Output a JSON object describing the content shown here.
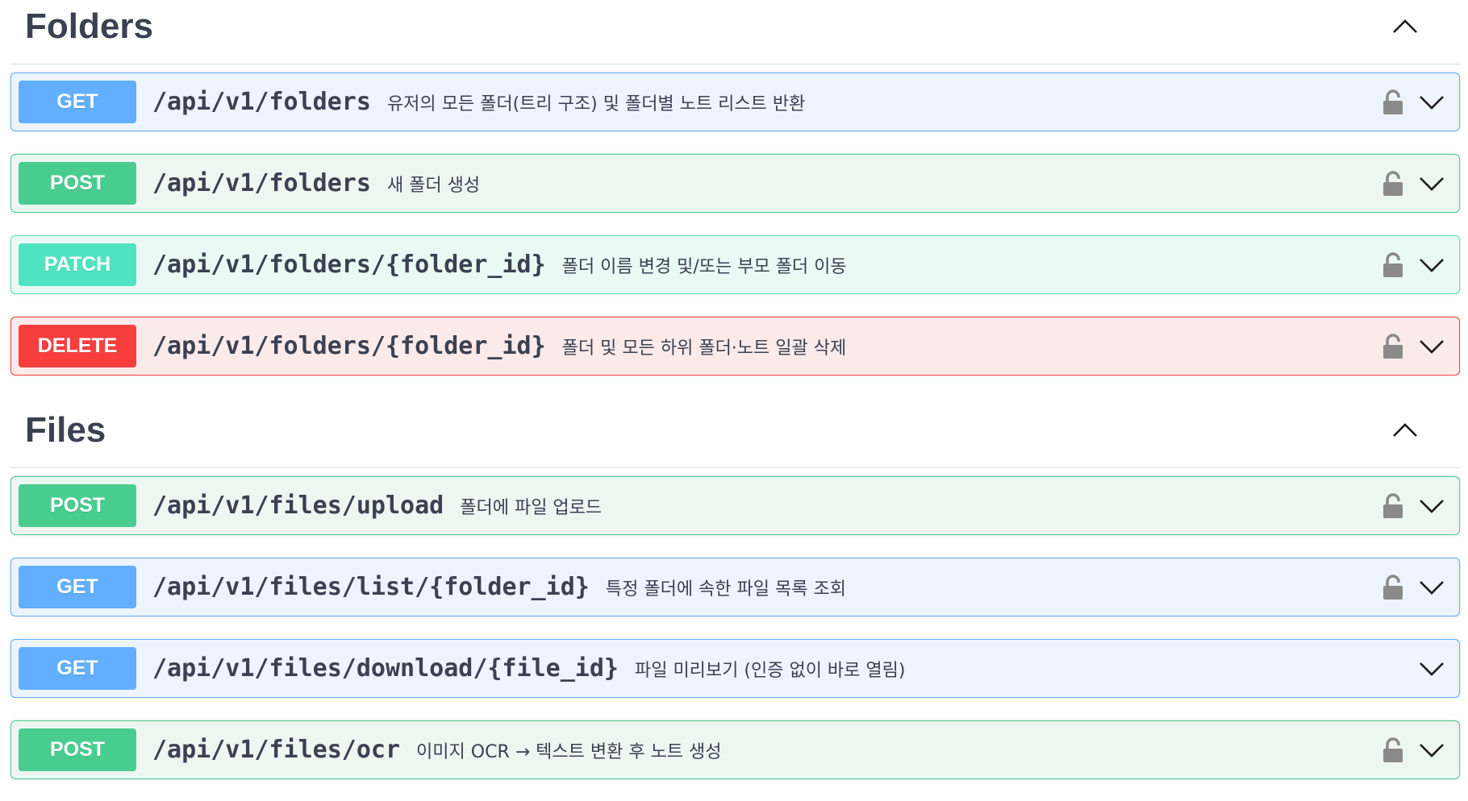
{
  "sections": [
    {
      "title": "Folders",
      "operations": [
        {
          "method": "GET",
          "path": "/api/v1/folders",
          "description": "유저의 모든 폴더(트리 구조) 및 폴더별 노트 리스트 반환",
          "locked": true
        },
        {
          "method": "POST",
          "path": "/api/v1/folders",
          "description": "새 폴더 생성",
          "locked": true
        },
        {
          "method": "PATCH",
          "path": "/api/v1/folders/{folder_id}",
          "description": "폴더 이름 변경 및/또는 부모 폴더 이동",
          "locked": true
        },
        {
          "method": "DELETE",
          "path": "/api/v1/folders/{folder_id}",
          "description": "폴더 및 모든 하위 폴더·노트 일괄 삭제",
          "locked": true
        }
      ]
    },
    {
      "title": "Files",
      "operations": [
        {
          "method": "POST",
          "path": "/api/v1/files/upload",
          "description": "폴더에 파일 업로드",
          "locked": true
        },
        {
          "method": "GET",
          "path": "/api/v1/files/list/{folder_id}",
          "description": "특정 폴더에 속한 파일 목록 조회",
          "locked": true
        },
        {
          "method": "GET",
          "path": "/api/v1/files/download/{file_id}",
          "description": "파일 미리보기 (인증 없이 바로 열림)",
          "locked": false
        },
        {
          "method": "POST",
          "path": "/api/v1/files/ocr",
          "description": "이미지 OCR → 텍스트 변환 후 노트 생성",
          "locked": true
        }
      ]
    }
  ],
  "colors": {
    "GET": "#61affe",
    "POST": "#49cc90",
    "PATCH": "#50e3c2",
    "DELETE": "#f93e3e"
  },
  "icons": {
    "section_toggle": "chevron-up-icon",
    "operation_toggle": "chevron-down-icon",
    "auth": "lock-icon"
  }
}
